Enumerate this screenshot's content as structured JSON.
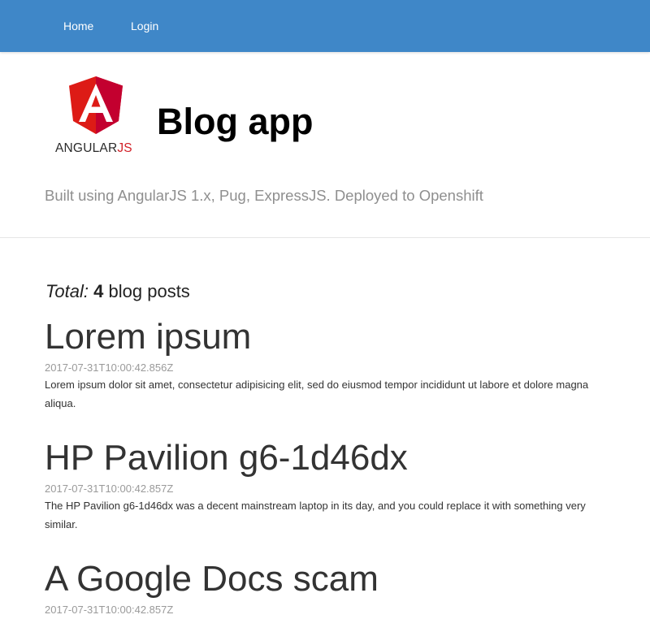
{
  "nav": {
    "items": [
      {
        "label": "Home"
      },
      {
        "label": "Login"
      }
    ],
    "background": "#3f87c8"
  },
  "hero": {
    "logo": {
      "icon": "angularjs-shield-icon",
      "wordmark_main": "ANGULAR",
      "wordmark_accent": "JS",
      "color": "#dd1b16"
    },
    "title": "Blog app",
    "tagline": "Built using AngularJS 1.x, Pug, ExpressJS. Deployed to Openshift"
  },
  "summary": {
    "label": "Total:",
    "count": "4",
    "suffix": "blog posts"
  },
  "posts": [
    {
      "title": "Lorem ipsum",
      "date": "2017-07-31T10:00:42.856Z",
      "body": "Lorem ipsum dolor sit amet, consectetur adipisicing elit, sed do eiusmod tempor incididunt ut labore et dolore magna aliqua."
    },
    {
      "title": "HP Pavilion g6-1d46dx",
      "date": "2017-07-31T10:00:42.857Z",
      "body": "The HP Pavilion g6-1d46dx was a decent mainstream laptop in its day, and you could replace it with something very similar."
    },
    {
      "title": "A Google Docs scam",
      "date": "2017-07-31T10:00:42.857Z",
      "body": ""
    }
  ]
}
